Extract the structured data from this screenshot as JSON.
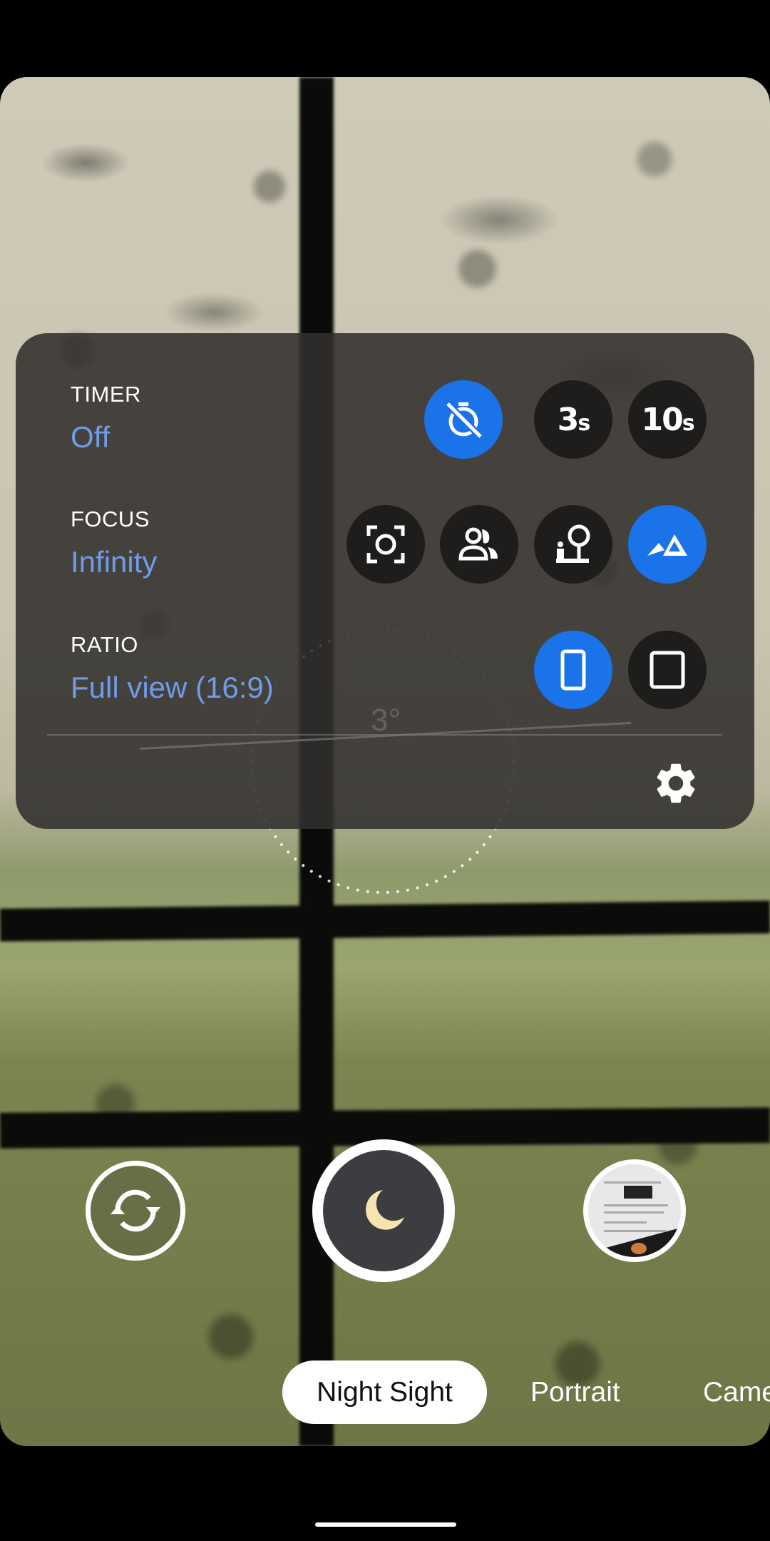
{
  "settings_panel": {
    "timer": {
      "label": "TIMER",
      "value": "Off",
      "options": [
        {
          "id": "off",
          "icon": "timer-off-icon",
          "selected": true
        },
        {
          "id": "3s",
          "text": "3",
          "suffix": "s",
          "selected": false
        },
        {
          "id": "10s",
          "text": "10",
          "suffix": "s",
          "selected": false
        }
      ]
    },
    "focus": {
      "label": "FOCUS",
      "value": "Infinity",
      "options": [
        {
          "id": "auto",
          "icon": "focus-auto-icon",
          "selected": false
        },
        {
          "id": "near",
          "icon": "people-icon",
          "selected": false
        },
        {
          "id": "far",
          "icon": "person-tree-icon",
          "selected": false
        },
        {
          "id": "infinity",
          "icon": "landscape-icon",
          "selected": true
        }
      ]
    },
    "ratio": {
      "label": "RATIO",
      "value": "Full view (16:9)",
      "options": [
        {
          "id": "full",
          "icon": "ratio-full-icon",
          "selected": true
        },
        {
          "id": "4:3",
          "icon": "ratio-4-3-icon",
          "selected": false
        }
      ]
    },
    "settings_icon": "gear-icon"
  },
  "level_indicator": {
    "angle_text": "3°"
  },
  "controls": {
    "switch_camera_icon": "switch-camera-icon",
    "shutter_icon": "moon-icon",
    "gallery_thumbnail": "gallery-thumbnail"
  },
  "modes": [
    {
      "label": "Night Sight",
      "active": true
    },
    {
      "label": "Portrait",
      "active": false
    },
    {
      "label": "Camera",
      "active": false
    }
  ],
  "colors": {
    "accent": "#1a73e8",
    "value_text": "#6f9be8",
    "option_bg": "#1e1d1c",
    "shutter_inner": "#3b3d40",
    "moon": "#f6e3b0"
  }
}
